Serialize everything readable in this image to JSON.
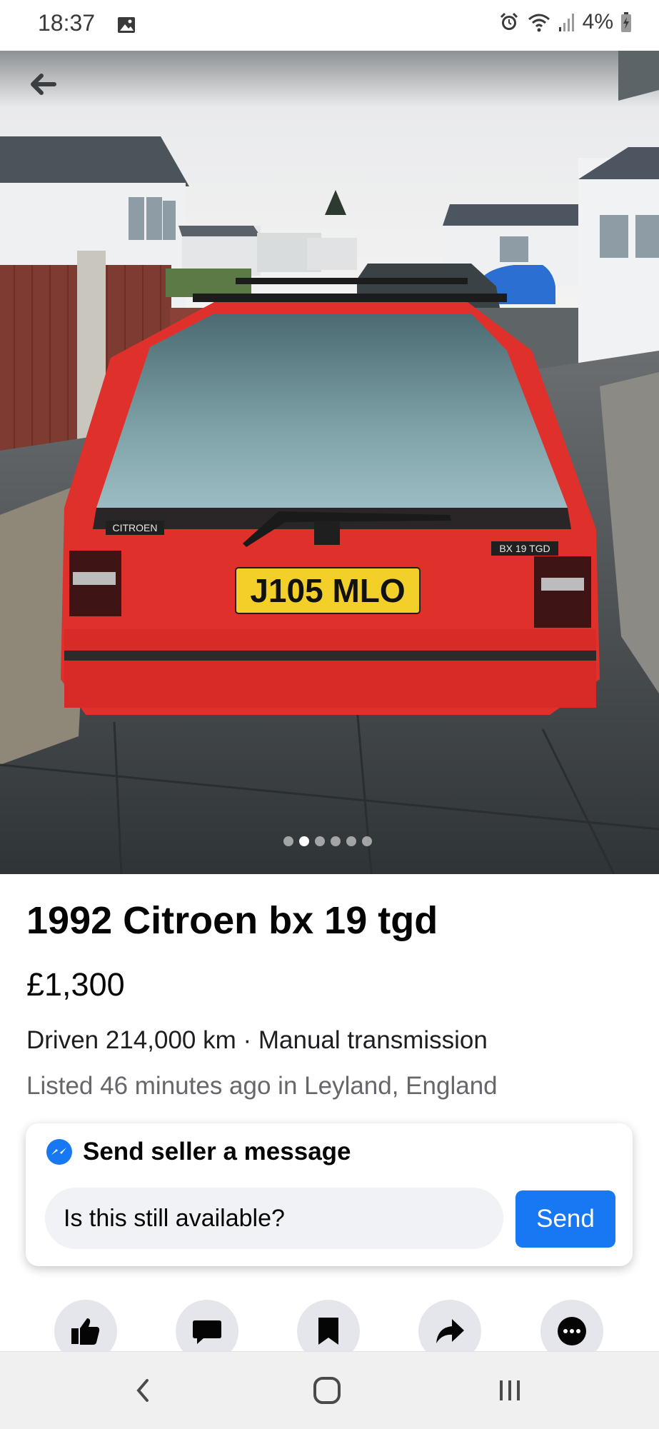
{
  "status_bar": {
    "time": "18:37",
    "battery": "4%",
    "icons": [
      "gallery-icon",
      "alarm-icon",
      "wifi-icon",
      "signal-icon",
      "battery-charging-icon"
    ]
  },
  "photo": {
    "plate_text": "J105 MLO",
    "badge_left": "CITROEN",
    "badge_right": "BX 19 TGD",
    "carousel": {
      "count": 6,
      "active_index": 1
    }
  },
  "listing": {
    "title": "1992 Citroen bx 19 tgd",
    "price": "£1,300",
    "details": "Driven 214,000 km · Manual transmission",
    "listed": "Listed 46 minutes ago in Leyland, England"
  },
  "message": {
    "header": "Send seller a message",
    "input_value": "Is this still available?",
    "send_label": "Send"
  },
  "actions": [
    "like-icon",
    "message-icon",
    "save-icon",
    "share-icon",
    "more-icon"
  ],
  "colors": {
    "accent": "#1877f2",
    "car_red": "#e0302b",
    "plate_yellow": "#f3cf2a"
  }
}
